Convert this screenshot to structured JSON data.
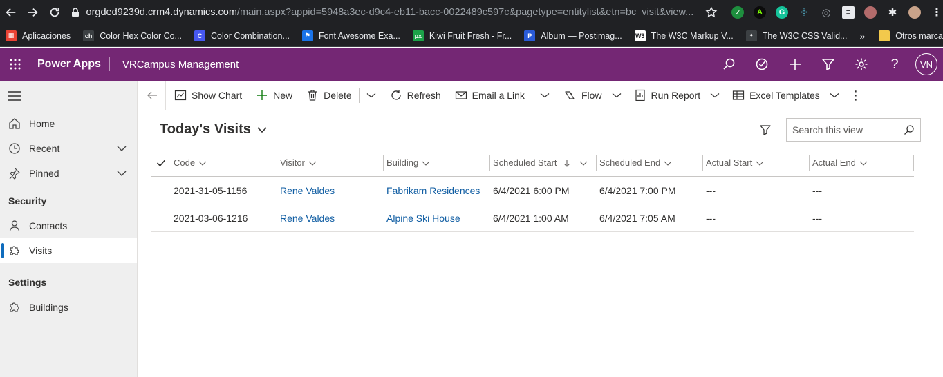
{
  "browser": {
    "url_host": "orgded9239d.crm4.dynamics.com",
    "url_path": "/main.aspx?appid=5948a3ec-d9c4-eb11-bacc-0022489c597c&pagetype=entitylist&etn=bc_visit&view...",
    "bookmarks": [
      {
        "label": "Aplicaciones",
        "color": "#ea4335",
        "glyph": "▦"
      },
      {
        "label": "Color Hex Color Co...",
        "color": "#3c4043",
        "glyph": "ch"
      },
      {
        "label": "Color Combination...",
        "color": "#4758f0",
        "glyph": "C"
      },
      {
        "label": "Font Awesome Exa...",
        "color": "#1a73e8",
        "glyph": "⚑"
      },
      {
        "label": "Kiwi Fruit Fresh - Fr...",
        "color": "#1ca349",
        "glyph": "px"
      },
      {
        "label": "Album — Postimag...",
        "color": "#2a5bd7",
        "glyph": "P"
      },
      {
        "label": "The W3C Markup V...",
        "color": "#ffffff",
        "glyph": "W3"
      },
      {
        "label": "The W3C CSS Valid...",
        "color": "#3c4043",
        "glyph": "✦"
      }
    ],
    "more_bookmarks": "»",
    "other_bookmarks": "Otros marcadores"
  },
  "header": {
    "brand": "Power Apps",
    "app_name": "VRCampus Management",
    "avatar_initials": "VN",
    "color": "#742774"
  },
  "sidebar": {
    "items_top": [
      {
        "label": "Home",
        "icon": "home-icon"
      },
      {
        "label": "Recent",
        "icon": "clock-icon",
        "expandable": true
      },
      {
        "label": "Pinned",
        "icon": "pin-icon",
        "expandable": true
      }
    ],
    "section_security": "Security",
    "items_security": [
      {
        "label": "Contacts",
        "icon": "person-icon"
      },
      {
        "label": "Visits",
        "icon": "puzzle-icon",
        "active": true
      }
    ],
    "section_settings": "Settings",
    "items_settings": [
      {
        "label": "Buildings",
        "icon": "puzzle-icon"
      }
    ]
  },
  "commands": {
    "show_chart": "Show Chart",
    "new": "New",
    "delete": "Delete",
    "refresh": "Refresh",
    "email_link": "Email a Link",
    "flow": "Flow",
    "run_report": "Run Report",
    "excel_templates": "Excel Templates"
  },
  "view": {
    "title": "Today's Visits",
    "search_placeholder": "Search this view"
  },
  "grid": {
    "columns": [
      "Code",
      "Visitor",
      "Building",
      "Scheduled Start",
      "Scheduled End",
      "Actual Start",
      "Actual End"
    ],
    "rows": [
      [
        "2021-31-05-1156",
        "Rene Valdes",
        "Fabrikam Residences",
        "6/4/2021 6:00 PM",
        "6/4/2021 7:00 PM",
        "---",
        "---"
      ],
      [
        "2021-03-06-1216",
        "Rene Valdes",
        "Alpine Ski House",
        "6/4/2021 1:00 AM",
        "6/4/2021 7:05 AM",
        "---",
        "---"
      ]
    ]
  }
}
